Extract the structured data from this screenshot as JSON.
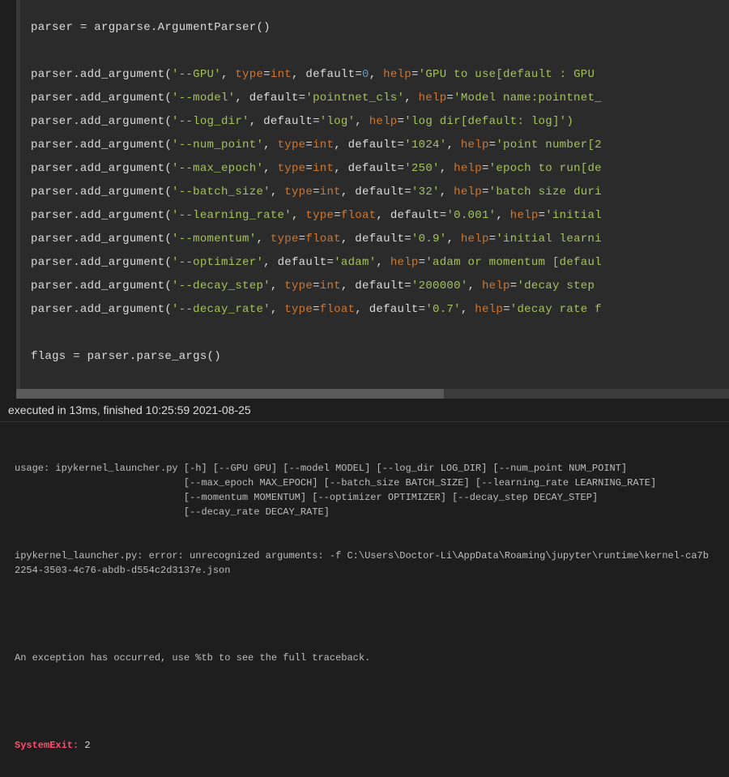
{
  "code": {
    "init": "parser = argparse.ArgumentParser()",
    "args": [
      {
        "flag": "'--GPU'",
        "type": "int",
        "default_raw": "0",
        "default_is_num": true,
        "help": "'GPU to use[default : GPU "
      },
      {
        "flag": "'--model'",
        "type": null,
        "default_raw": "'pointnet_cls'",
        "default_is_num": false,
        "help": "'Model name:pointnet_"
      },
      {
        "flag": "'--log_dir'",
        "type": null,
        "default_raw": "'log'",
        "default_is_num": false,
        "help": "'log dir[default: log]')"
      },
      {
        "flag": "'--num_point'",
        "type": "int",
        "default_raw": "'1024'",
        "default_is_num": false,
        "help": "'point number[2"
      },
      {
        "flag": "'--max_epoch'",
        "type": "int",
        "default_raw": "'250'",
        "default_is_num": false,
        "help": "'epoch to run[de"
      },
      {
        "flag": "'--batch_size'",
        "type": "int",
        "default_raw": "'32'",
        "default_is_num": false,
        "help": "'batch size duri"
      },
      {
        "flag": "'--learning_rate'",
        "type": "float",
        "default_raw": "'0.001'",
        "default_is_num": false,
        "help": "'initial"
      },
      {
        "flag": "'--momentum'",
        "type": "float",
        "default_raw": "'0.9'",
        "default_is_num": false,
        "help": "'initial learni"
      },
      {
        "flag": "'--optimizer'",
        "type": null,
        "default_raw": "'adam'",
        "default_is_num": false,
        "help": "'adam or momentum [defaul"
      },
      {
        "flag": "'--decay_step'",
        "type": "int",
        "default_raw": "'200000'",
        "default_is_num": false,
        "help": "'decay step "
      },
      {
        "flag": "'--decay_rate'",
        "type": "float",
        "default_raw": "'0.7'",
        "default_is_num": false,
        "help": "'decay rate f"
      }
    ],
    "tail": "flags = parser.parse_args()"
  },
  "status": "executed in 13ms, finished 10:25:59 2021-08-25",
  "output": {
    "usage_lines": [
      "usage: ipykernel_launcher.py [-h] [--GPU GPU] [--model MODEL] [--log_dir LOG_DIR] [--num_point NUM_POINT]",
      "                             [--max_epoch MAX_EPOCH] [--batch_size BATCH_SIZE] [--learning_rate LEARNING_RATE]",
      "                             [--momentum MOMENTUM] [--optimizer OPTIMIZER] [--decay_step DECAY_STEP]",
      "                             [--decay_rate DECAY_RATE]"
    ],
    "error_line": "ipykernel_launcher.py: error: unrecognized arguments: -f C:\\Users\\Doctor-Li\\AppData\\Roaming\\jupyter\\runtime\\kernel-ca7b2254-3503-4c76-abdb-d554c2d3137e.json",
    "exception_msg": "An exception has occurred, use %tb to see the full traceback.",
    "sysexit_label": "SystemExit:",
    "sysexit_code": " 2"
  }
}
